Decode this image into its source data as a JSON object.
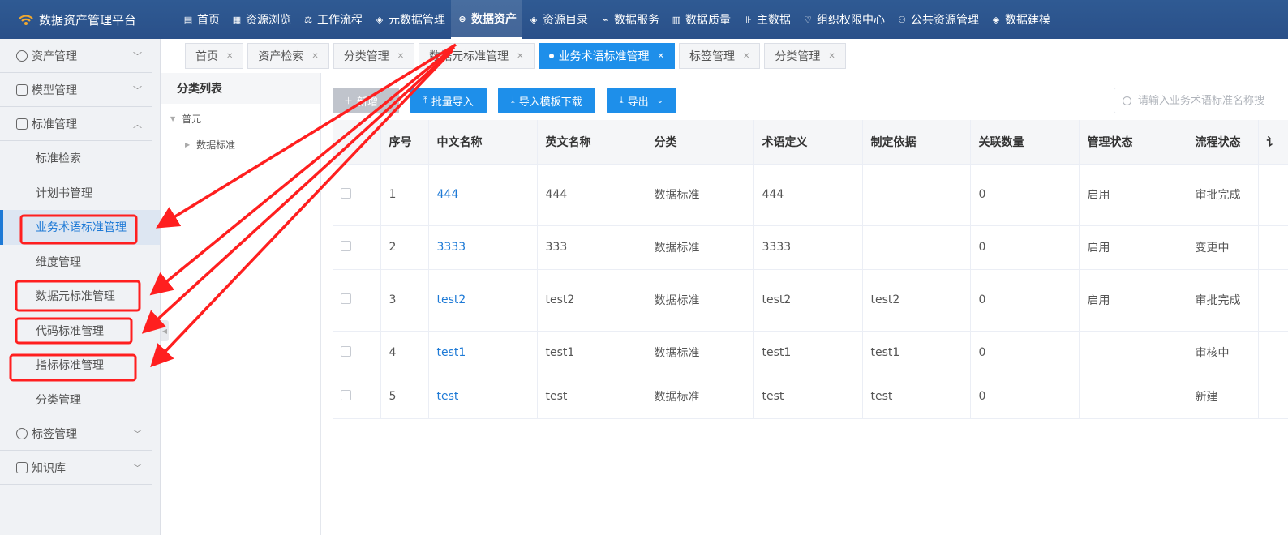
{
  "app": {
    "title": "数据资产管理平台"
  },
  "nav": [
    {
      "label": "首页",
      "icon": "document-icon"
    },
    {
      "label": "资源浏览",
      "icon": "grid-list-icon"
    },
    {
      "label": "工作流程",
      "icon": "workflow-icon"
    },
    {
      "label": "元数据管理",
      "icon": "layers-icon"
    },
    {
      "label": "数据资产",
      "icon": "asset-icon",
      "active": true
    },
    {
      "label": "资源目录",
      "icon": "layers-icon"
    },
    {
      "label": "数据服务",
      "icon": "service-icon"
    },
    {
      "label": "数据质量",
      "icon": "chart-icon"
    },
    {
      "label": "主数据",
      "icon": "master-data-icon"
    },
    {
      "label": "组织权限中心",
      "icon": "shield-icon"
    },
    {
      "label": "公共资源管理",
      "icon": "users-icon"
    },
    {
      "label": "数据建模",
      "icon": "layers-icon"
    }
  ],
  "sidebar": {
    "groups": [
      {
        "label": "资产管理",
        "icon": "clock-icon",
        "chevron": "down"
      },
      {
        "label": "模型管理",
        "icon": "line-chart-icon",
        "chevron": "down"
      },
      {
        "label": "标准管理",
        "icon": "document-icon",
        "chevron": "up"
      }
    ],
    "items": [
      {
        "label": "标准检索"
      },
      {
        "label": "计划书管理"
      },
      {
        "label": "业务术语标准管理",
        "active": true
      },
      {
        "label": "维度管理"
      },
      {
        "label": "数据元标准管理"
      },
      {
        "label": "代码标准管理"
      },
      {
        "label": "指标标准管理"
      },
      {
        "label": "分类管理"
      }
    ],
    "groups_after": [
      {
        "label": "标签管理",
        "icon": "plus-circle-icon",
        "chevron": "down"
      },
      {
        "label": "知识库",
        "icon": "tag-icon",
        "chevron": "down"
      }
    ]
  },
  "tabs": [
    {
      "label": "首页"
    },
    {
      "label": "资产检索"
    },
    {
      "label": "分类管理"
    },
    {
      "label": "数据元标准管理"
    },
    {
      "label": "业务术语标准管理",
      "active": true
    },
    {
      "label": "标签管理"
    },
    {
      "label": "分类管理"
    }
  ],
  "category_panel": {
    "title": "分类列表",
    "root": "普元",
    "child": "数据标准"
  },
  "toolbar": {
    "add": "新增",
    "batch_import": "批量导入",
    "template_download": "导入模板下载",
    "export": "导出"
  },
  "search": {
    "placeholder": "请输入业务术语标准名称搜"
  },
  "table": {
    "columns": [
      "序号",
      "中文名称",
      "英文名称",
      "分类",
      "术语定义",
      "制定依据",
      "关联数量",
      "管理状态",
      "流程状态",
      "讠"
    ],
    "rows": [
      [
        "1",
        "444",
        "444",
        "数据标准",
        "444",
        "",
        "0",
        "启用",
        "审批完成"
      ],
      [
        "2",
        "3333",
        "333",
        "数据标准",
        "3333",
        "",
        "0",
        "启用",
        "变更中"
      ],
      [
        "3",
        "test2",
        "test2",
        "数据标准",
        "test2",
        "test2",
        "0",
        "启用",
        "审批完成"
      ],
      [
        "4",
        "test1",
        "test1",
        "数据标准",
        "test1",
        "test1",
        "0",
        "",
        "审核中"
      ],
      [
        "5",
        "test",
        "test",
        "数据标准",
        "test",
        "test",
        "0",
        "",
        "新建"
      ]
    ]
  },
  "colors": {
    "topbar": "#2c5590",
    "accent": "#1e8fea",
    "link": "#1e7ad6",
    "annotation": "#ff1f1f"
  }
}
